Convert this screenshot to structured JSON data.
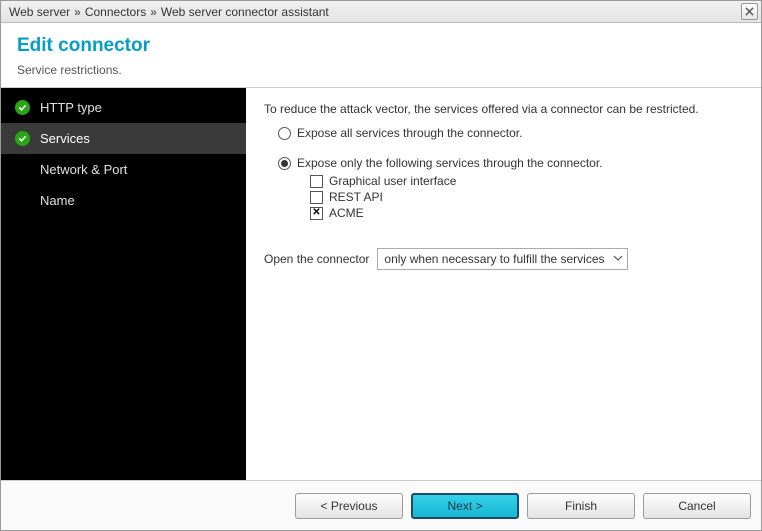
{
  "breadcrumb": [
    "Web server",
    "Connectors",
    "Web server connector assistant"
  ],
  "header": {
    "title": "Edit connector",
    "subtitle": "Service restrictions."
  },
  "sidebar": {
    "steps": [
      {
        "label": "HTTP type",
        "done": true,
        "active": false
      },
      {
        "label": "Services",
        "done": true,
        "active": true
      },
      {
        "label": "Network & Port",
        "done": false,
        "active": false
      },
      {
        "label": "Name",
        "done": false,
        "active": false
      }
    ]
  },
  "content": {
    "intro": "To reduce the attack vector, the services offered via a connector can be restricted.",
    "options": [
      {
        "label": "Expose all services through the connector.",
        "selected": false
      },
      {
        "label": "Expose only the following services through the connector.",
        "selected": true
      }
    ],
    "services": [
      {
        "label": "Graphical user interface",
        "checked": false
      },
      {
        "label": "REST API",
        "checked": false
      },
      {
        "label": "ACME",
        "checked": true
      }
    ],
    "open_label": "Open the connector",
    "open_value": "only when necessary to fulfill the services"
  },
  "buttons": {
    "previous": "< Previous",
    "next": "Next >",
    "finish": "Finish",
    "cancel": "Cancel"
  }
}
